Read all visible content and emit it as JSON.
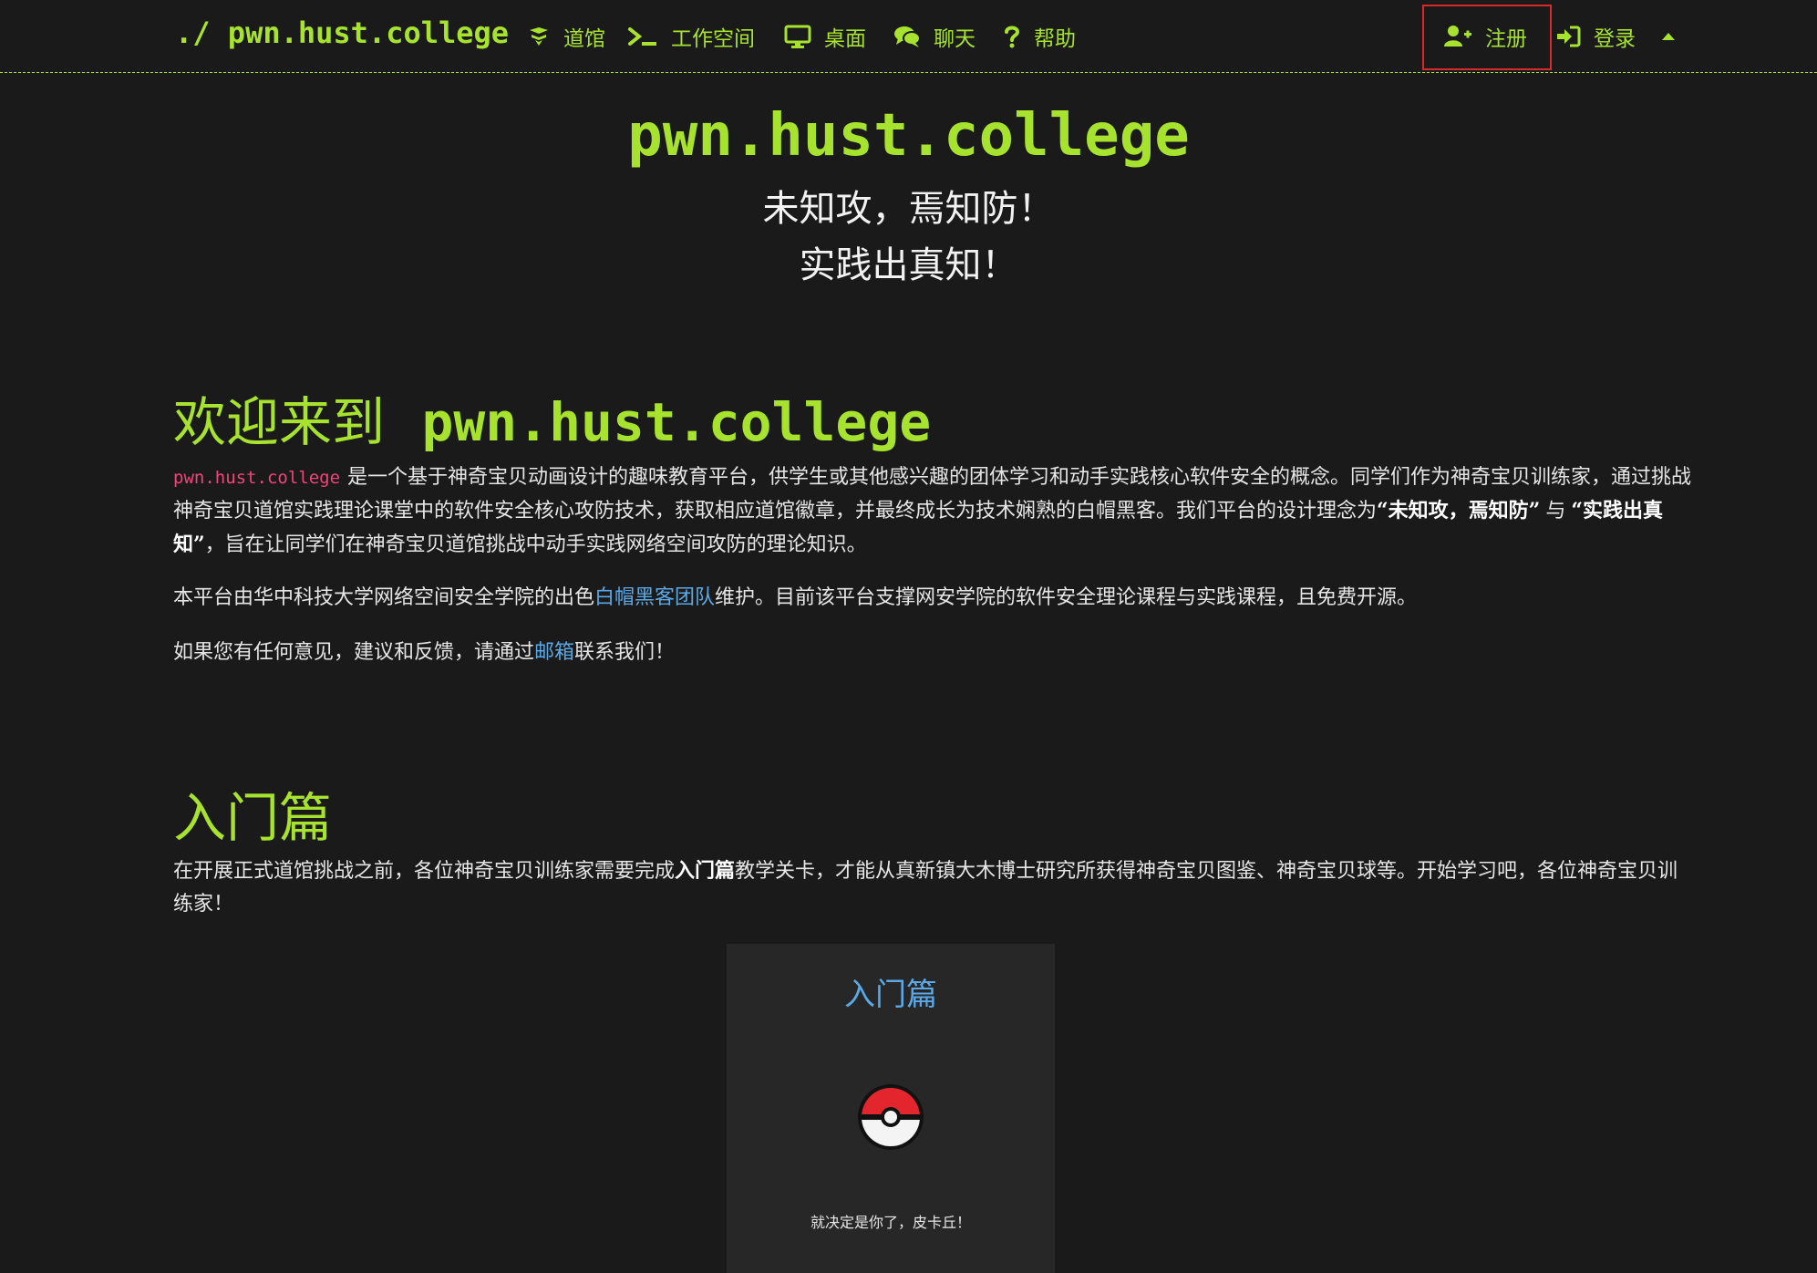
{
  "navbar": {
    "brand": "./ pwn.hust.college",
    "items": [
      {
        "label": "道馆",
        "icon": "dojo-icon"
      },
      {
        "label": "工作空间",
        "icon": "terminal-icon"
      },
      {
        "label": "桌面",
        "icon": "desktop-icon"
      },
      {
        "label": "聊天",
        "icon": "chat-icon"
      },
      {
        "label": "帮助",
        "icon": "help-icon"
      }
    ],
    "register": {
      "label": "注册",
      "icon": "user-plus-icon"
    },
    "login": {
      "label": "登录",
      "icon": "sign-in-icon"
    },
    "toggle_icon": "caret-up-icon"
  },
  "hero": {
    "title": "pwn.hust.college",
    "line1": "未知攻，焉知防！",
    "line2": "实践出真知！"
  },
  "welcome": {
    "title_prefix": "欢迎来到",
    "title_site": "pwn.hust.college",
    "p1": {
      "code": "pwn.hust.college",
      "text_a": "是一个基于神奇宝贝动画设计的趣味教育平台，供学生或其他感兴趣的团体学习和动手实践核心软件安全的概念。同学们作为神奇宝贝训练家，通过挑战神奇宝贝道馆实践理论课堂中的软件安全核心攻防技术，获取相应道馆徽章，并最终成长为技术娴熟的白帽黑客。我们平台的设计理念为",
      "bold_1": "“未知攻，焉知防”",
      "text_b": "与",
      "bold_2": "“实践出真知”",
      "text_c": "，旨在让同学们在神奇宝贝道馆挑战中动手实践网络空间攻防的理论知识。"
    },
    "p2": {
      "text_a": "本平台由华中科技大学网络空间安全学院的出色",
      "link": "白帽黑客团队",
      "text_b": "维护。目前该平台支撑网安学院的软件安全理论课程与实践课程，且免费开源。"
    },
    "p3": {
      "text_a": "如果您有任何意见，建议和反馈，请通过",
      "link": "邮箱",
      "text_b": "联系我们！"
    }
  },
  "intro": {
    "title": "入门篇",
    "p": {
      "text_a": "在开展正式道馆挑战之前，各位神奇宝贝训练家需要完成",
      "bold": "入门篇",
      "text_b": "教学关卡，才能从真新镇大木博士研究所获得神奇宝贝图鉴、神奇宝贝球等。开始学习吧，各位神奇宝贝训练家！"
    },
    "card": {
      "title": "入门篇",
      "icon": "pokeball-icon",
      "caption": "就决定是你了，皮卡丘！"
    }
  },
  "colors": {
    "accent": "#a6e22e",
    "background": "#1a1a1a",
    "link": "#5aa9e6",
    "code": "#f0457a",
    "highlight": "#d82a2a"
  }
}
